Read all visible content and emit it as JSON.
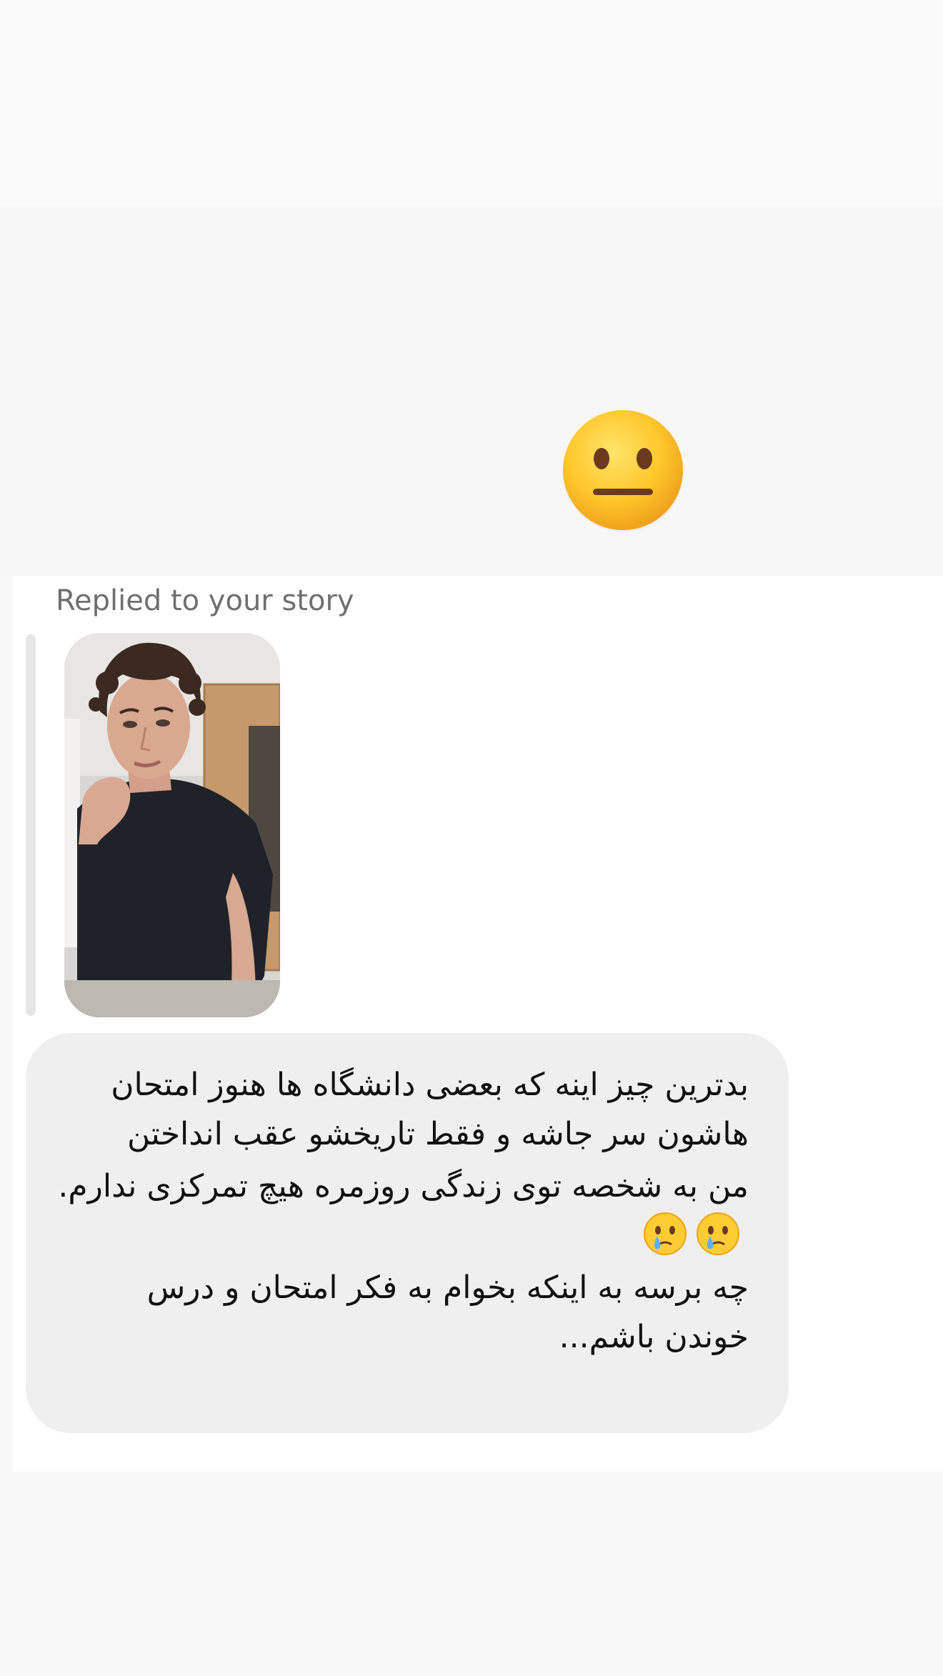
{
  "reaction": {
    "icon": "neutral-face-emoji"
  },
  "message": {
    "replied_label": "Replied to your story",
    "story_thumbnail": {
      "icon": "story-photo",
      "alt": "Story thumbnail"
    },
    "lines": [
      "بدترین چیز اینه که بعضی دانشگاه ها هنوز امتحان هاشون سر جاشه و فقط تاریخشو عقب انداختن",
      "من به شخصه توی زندگی روزمره هیچ تمرکزی ندارم.",
      "چه برسه به اینکه بخوام به فکر امتحان و درس خوندن باشم..."
    ],
    "line2_emojis": [
      "crying-face-emoji",
      "crying-face-emoji"
    ]
  },
  "colors": {
    "bubble": "#efefef",
    "label": "#6f6f6f",
    "text": "#111111",
    "card": "#ffffff"
  }
}
